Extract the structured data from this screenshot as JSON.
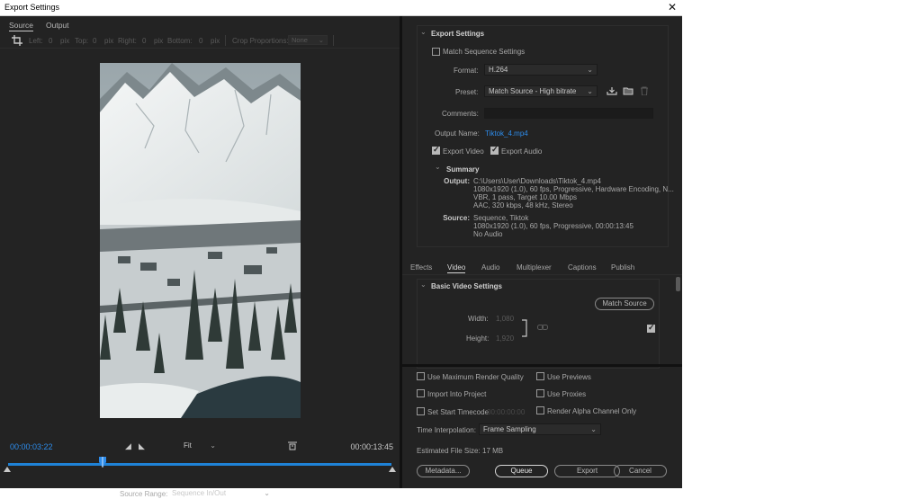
{
  "window": {
    "title": "Export Settings",
    "close_label": "✕"
  },
  "source_panel": {
    "tabs": [
      {
        "label": "Source",
        "active": true
      },
      {
        "label": "Output",
        "active": false
      }
    ],
    "crop": {
      "left_label": "Left:",
      "left_value": "0",
      "left_unit": "pix",
      "top_label": "Top:",
      "top_value": "0",
      "top_unit": "pix",
      "right_label": "Right:",
      "right_value": "0",
      "right_unit": "pix",
      "bottom_label": "Bottom:",
      "bottom_value": "0",
      "bottom_unit": "pix",
      "proportions_label": "Crop Proportions:",
      "proportions_value": "None"
    },
    "preview_image": "snowy-mountain-valley-vertical-video-frame",
    "timeline": {
      "current_time": "00:00:03:22",
      "duration": "00:00:13:45",
      "playhead_fraction": 0.245,
      "zoom_value": "Fit",
      "source_range_label": "Source Range:",
      "source_range_value": "Sequence In/Out"
    }
  },
  "export_settings": {
    "header": "Export Settings",
    "match_sequence_label": "Match Sequence Settings",
    "match_sequence_checked": false,
    "format_label": "Format:",
    "format_value": "H.264",
    "preset_label": "Preset:",
    "preset_value": "Match Source - High bitrate",
    "comments_label": "Comments:",
    "comments_value": "",
    "output_name_label": "Output Name:",
    "output_name_value": "Tiktok_4.mp4",
    "export_video_label": "Export Video",
    "export_video_checked": true,
    "export_audio_label": "Export Audio",
    "export_audio_checked": true,
    "summary": {
      "header": "Summary",
      "output_key": "Output:",
      "output_lines": [
        "C:\\Users\\User\\Downloads\\Tiktok_4.mp4",
        "1080x1920 (1.0), 60 fps, Progressive, Hardware Encoding, N...",
        "VBR, 1 pass, Target 10.00 Mbps",
        "AAC, 320 kbps, 48 kHz, Stereo"
      ],
      "source_key": "Source:",
      "source_lines": [
        "Sequence, Tiktok",
        "1080x1920 (1.0), 60 fps, Progressive, 00:00:13:45",
        "No Audio"
      ]
    }
  },
  "settings_tabs": [
    {
      "label": "Effects",
      "active": false
    },
    {
      "label": "Video",
      "active": true
    },
    {
      "label": "Audio",
      "active": false
    },
    {
      "label": "Multiplexer",
      "active": false
    },
    {
      "label": "Captions",
      "active": false
    },
    {
      "label": "Publish",
      "active": false
    }
  ],
  "video_settings": {
    "header": "Basic Video Settings",
    "match_source_button": "Match Source",
    "width_label": "Width:",
    "width_value": "1,080",
    "height_label": "Height:",
    "height_value": "1,920",
    "checkbox_checked": true
  },
  "bottom_options": {
    "max_render_quality": {
      "label": "Use Maximum Render Quality",
      "checked": false
    },
    "use_previews": {
      "label": "Use Previews",
      "checked": false
    },
    "import_into_project": {
      "label": "Import Into Project",
      "checked": false
    },
    "use_proxies": {
      "label": "Use Proxies",
      "checked": false
    },
    "set_start_timecode": {
      "label": "Set Start Timecode",
      "checked": false,
      "value": "00:00:00:00"
    },
    "render_alpha": {
      "label": "Render Alpha Channel Only",
      "checked": false
    },
    "time_interpolation_label": "Time Interpolation:",
    "time_interpolation_value": "Frame Sampling",
    "file_size_label": "Estimated File Size:",
    "file_size_value": "17 MB"
  },
  "buttons": {
    "metadata": "Metadata...",
    "queue": "Queue",
    "export": "Export",
    "cancel": "Cancel"
  }
}
